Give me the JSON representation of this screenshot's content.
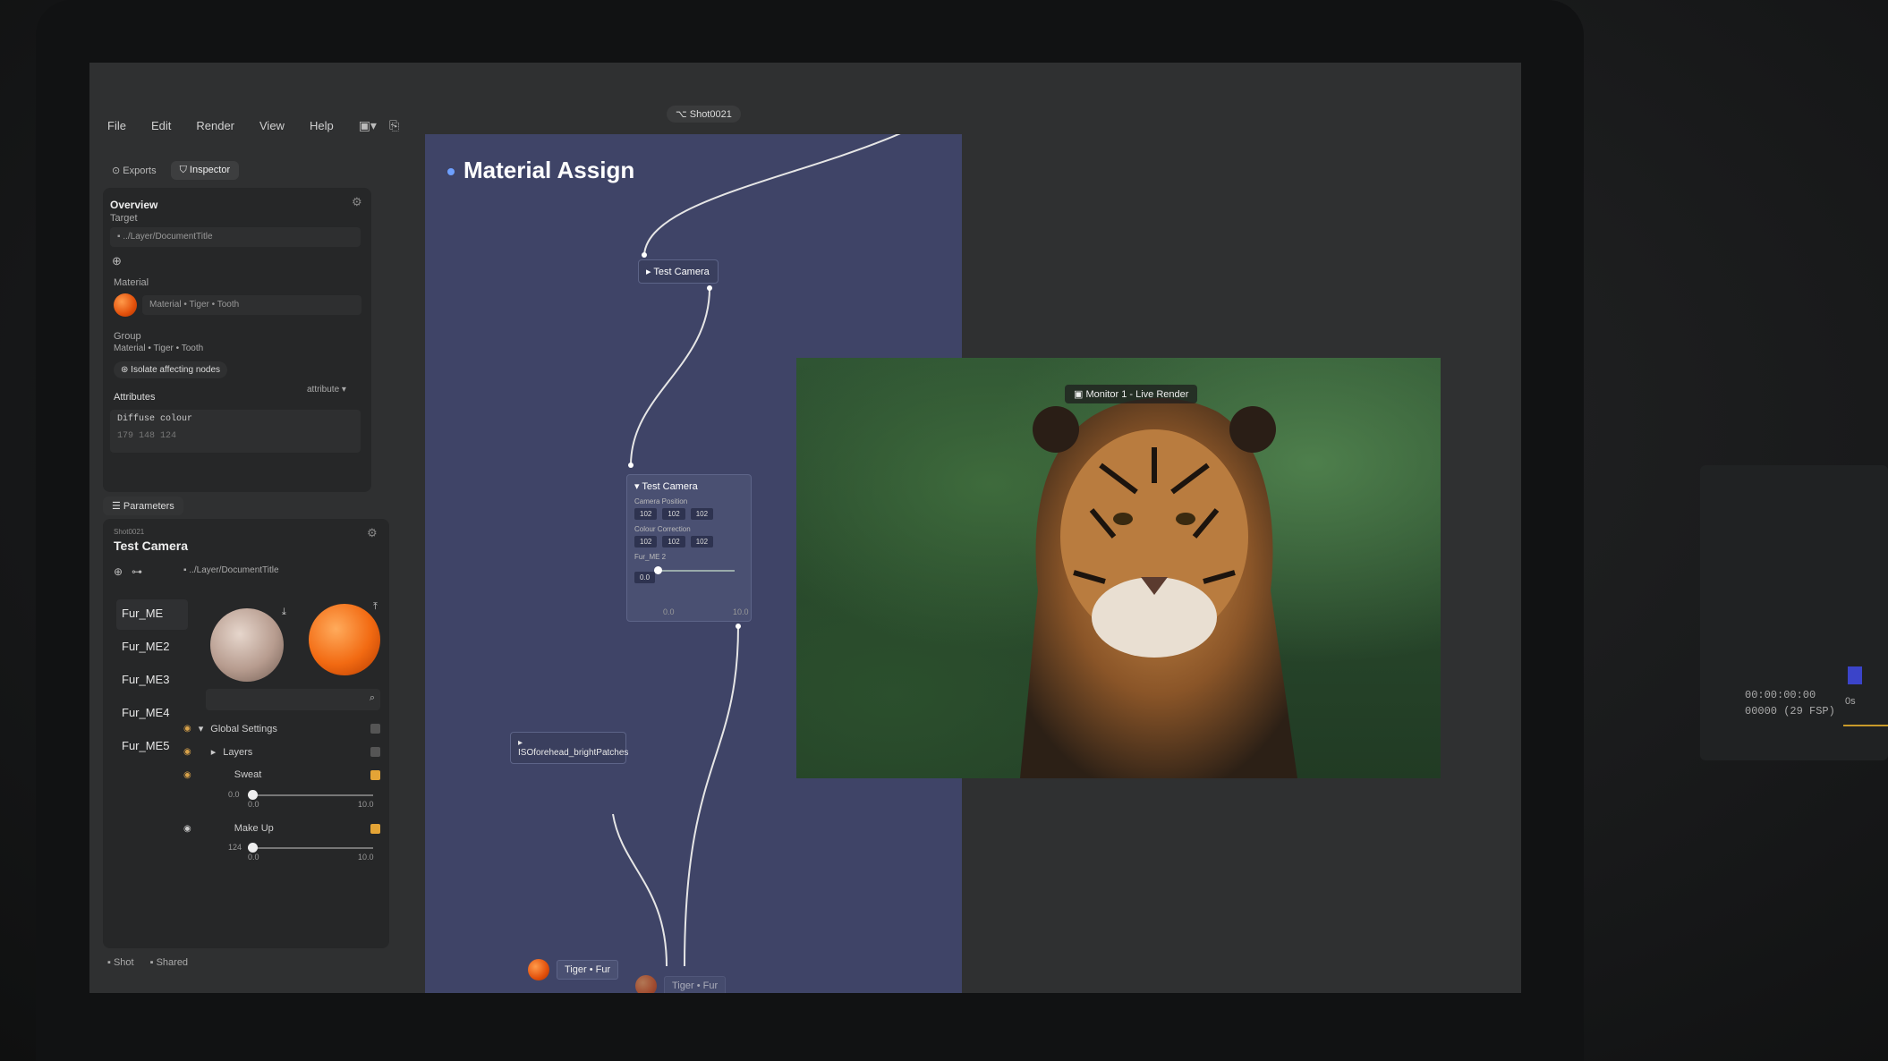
{
  "menu": [
    "File",
    "Edit",
    "Render",
    "View",
    "Help"
  ],
  "shot_pill": "Shot0021",
  "left_tabs": [
    "Exports",
    "Inspector"
  ],
  "inspector": {
    "overview": "Overview",
    "target_label": "Target",
    "target_path": "../Layer/DocumentTitle",
    "material_label": "Material",
    "material_value": "Material • Tiger • Tooth",
    "group_label": "Group",
    "group_value": "Material • Tiger • Tooth",
    "isolate_button": "Isolate affecting nodes",
    "attributes_label": "Attributes",
    "attribute_dropdown": "attribute",
    "attr_name": "Diffuse colour",
    "attr_value": "179 148 124"
  },
  "parameters": {
    "tab_label": "Parameters",
    "shot_small": "Shot0021",
    "title": "Test Camera",
    "path": "../Layer/DocumentTitle",
    "fur_items": [
      "Fur_ME",
      "Fur_ME2",
      "Fur_ME3",
      "Fur_ME4",
      "Fur_ME5"
    ],
    "global_settings": "Global Settings",
    "layers": "Layers",
    "sweat": "Sweat",
    "sweat_min": "0.0",
    "sweat_val": "0.0",
    "sweat_max": "10.0",
    "makeup": "Make Up",
    "makeup_num": "124",
    "makeup_min": "0.0",
    "makeup_max": "10.0",
    "sweat_level": 0.0,
    "makeup_level": 0.0
  },
  "footer_tabs": [
    "Shot",
    "Shared"
  ],
  "graph": {
    "title": "Material Assign",
    "node1": "Test Camera",
    "node2": {
      "title": "Test Camera",
      "row1": "Camera Position",
      "row1_vals": [
        "102",
        "102",
        "102"
      ],
      "row2": "Colour Correction",
      "row2_vals": [
        "102",
        "102",
        "102"
      ],
      "row3": "Fur_ME 2",
      "row3_val": "0.0",
      "slider_min": "0.0",
      "slider_max": "10.0"
    },
    "patch_node": "ISOforehead_brightPatches",
    "tiger_node": "Tiger • Fur",
    "tiger_node2": "Tiger • Fur"
  },
  "viewport": {
    "monitor_label": "Monitor 1 - Live Render"
  },
  "side_device": {
    "timecode": "00:00:00:00",
    "frames": "00000 (29 FSP)",
    "seconds": "0s"
  }
}
